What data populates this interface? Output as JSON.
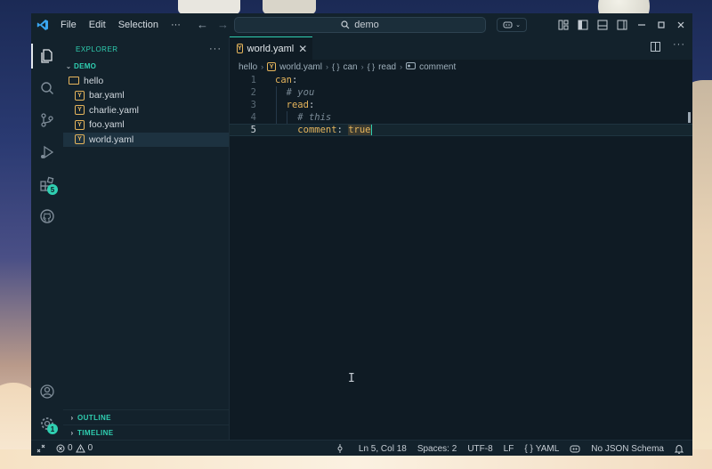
{
  "titlebar": {
    "menu": [
      "File",
      "Edit",
      "Selection",
      "···"
    ],
    "search_text": "demo"
  },
  "activity": {
    "extensions_badge": "5",
    "settings_badge": "1"
  },
  "sidebar": {
    "title": "EXPLORER",
    "more": "···",
    "root": "DEMO",
    "folder": "hello",
    "files": [
      "bar.yaml",
      "charlie.yaml",
      "foo.yaml",
      "world.yaml"
    ],
    "sections": [
      "OUTLINE",
      "TIMELINE"
    ]
  },
  "editor": {
    "tab_label": "world.yaml",
    "breadcrumb": [
      "hello",
      "world.yaml",
      "can",
      "read",
      "comment"
    ],
    "line_numbers": [
      "1",
      "2",
      "3",
      "4",
      "5"
    ],
    "code": {
      "l1_key": "can",
      "l2_comment": "# you",
      "l3_key": "read",
      "l4_comment": "# this",
      "l5_key": "comment",
      "l5_value": "true"
    }
  },
  "status": {
    "errors": "0",
    "warnings": "0",
    "position": "Ln 5, Col 18",
    "spaces": "Spaces: 2",
    "encoding": "UTF-8",
    "eol": "LF",
    "language": "YAML",
    "schema": "No JSON Schema"
  },
  "colors": {
    "accent": "#2fcfb1",
    "yaml_key": "#e6b55c",
    "editor_bg": "#0f1b24"
  }
}
